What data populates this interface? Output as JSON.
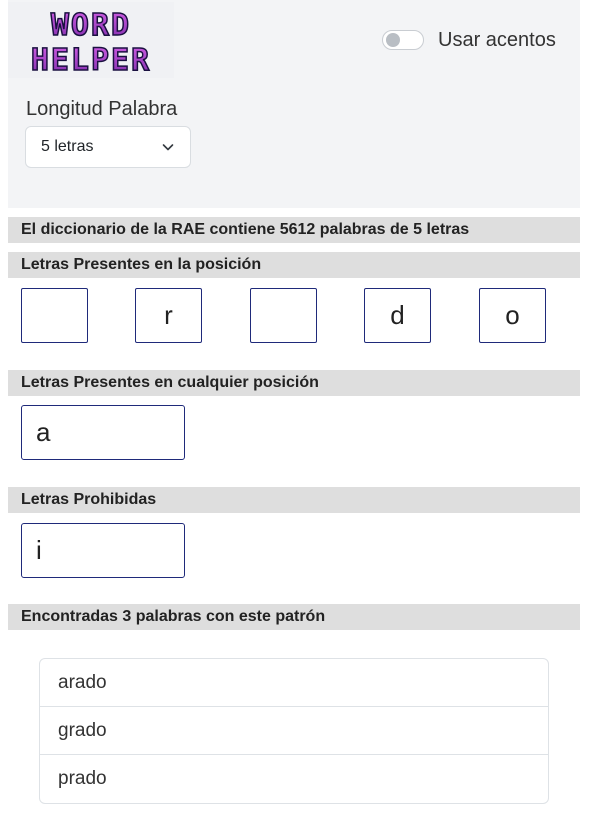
{
  "logo": {
    "line1": "WORD",
    "line2": "HELPER"
  },
  "accent_toggle": {
    "label": "Usar acentos",
    "on": false
  },
  "length": {
    "label": "Longitud Palabra",
    "selected": "5 letras"
  },
  "dictionary_info": "El diccionario de la RAE contiene 5612 palabras de 5 letras",
  "positions": {
    "title": "Letras Presentes en la posición",
    "letters": [
      "",
      "r",
      "",
      "d",
      "o"
    ]
  },
  "any_position": {
    "title": "Letras Presentes en cualquier posición",
    "value": "a"
  },
  "forbidden": {
    "title": "Letras Prohibidas",
    "value": "i"
  },
  "results": {
    "title": "Encontradas 3 palabras con este patrón",
    "words": [
      "arado",
      "grado",
      "prado"
    ]
  },
  "colors": {
    "logo_fill": "#a23cc4",
    "logo_outline": "#1a1040",
    "input_border": "#1f2a7a",
    "bar_bg": "#dedede"
  }
}
